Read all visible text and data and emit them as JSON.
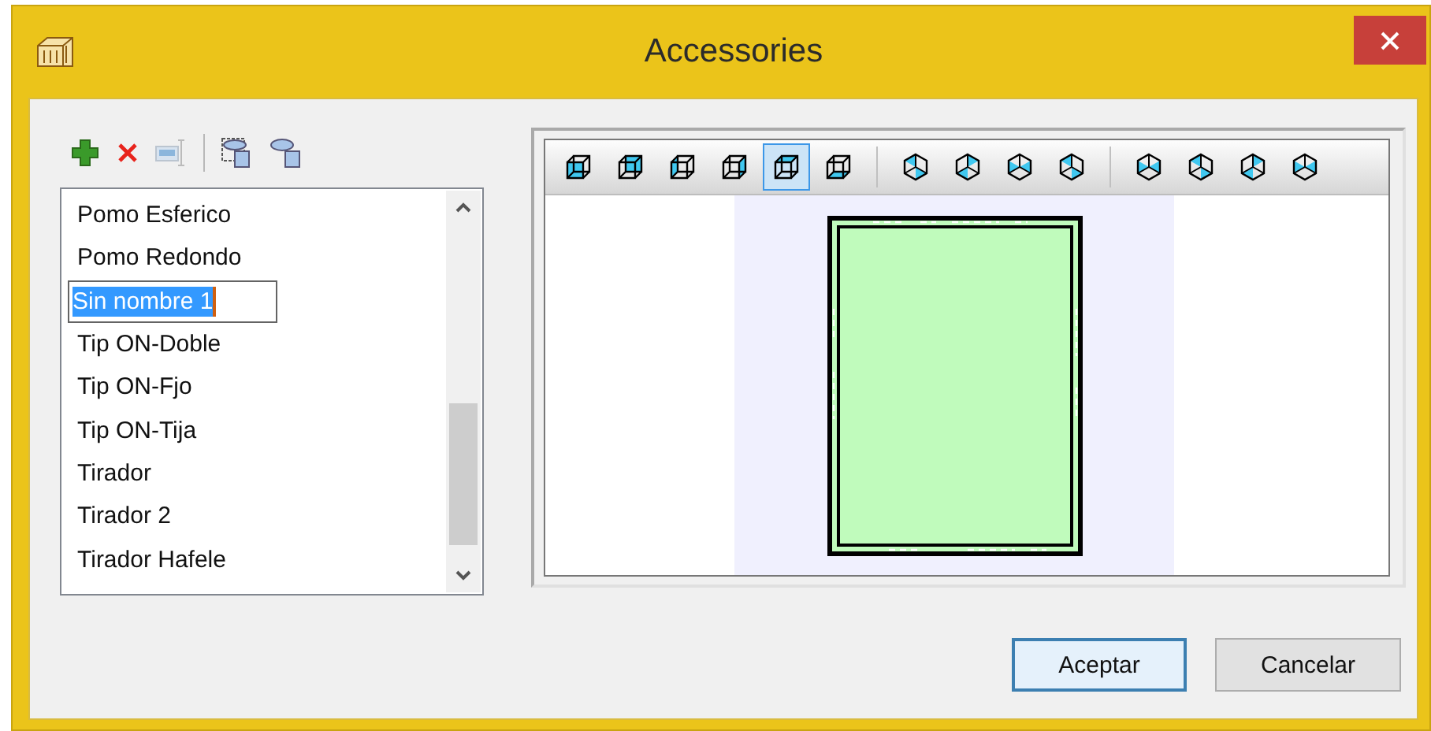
{
  "window": {
    "title": "Accessories"
  },
  "list_toolbar": [
    {
      "kind": "add"
    },
    {
      "kind": "delete"
    },
    {
      "kind": "rename",
      "disabled": true
    },
    {
      "kind": "separator"
    },
    {
      "kind": "copy"
    },
    {
      "kind": "shapes"
    }
  ],
  "list": {
    "items": [
      {
        "label": "Pomo Esferico",
        "editing": false
      },
      {
        "label": "Pomo Redondo",
        "editing": false
      },
      {
        "label": "Sin nombre 1",
        "editing": true
      },
      {
        "label": "Tip ON-Doble",
        "editing": false
      },
      {
        "label": "Tip ON-Fjo",
        "editing": false
      },
      {
        "label": "Tip ON-Tija",
        "editing": false
      },
      {
        "label": "Tirador",
        "editing": false
      },
      {
        "label": "Tirador 2",
        "editing": false
      },
      {
        "label": "Tirador Hafele",
        "editing": false
      }
    ]
  },
  "view_toolbar": [
    {
      "buttons": [
        {
          "selected": false
        },
        {
          "selected": false
        },
        {
          "selected": false
        },
        {
          "selected": false
        },
        {
          "selected": true
        },
        {
          "selected": false
        }
      ]
    },
    {
      "buttons": [
        {
          "selected": false
        },
        {
          "selected": false
        },
        {
          "selected": false
        },
        {
          "selected": false
        }
      ]
    },
    {
      "buttons": [
        {
          "selected": false
        },
        {
          "selected": false
        },
        {
          "selected": false
        },
        {
          "selected": false
        }
      ]
    }
  ],
  "buttons": [
    {
      "label": "Aceptar",
      "default": true
    },
    {
      "label": "Cancelar",
      "default": false
    }
  ]
}
